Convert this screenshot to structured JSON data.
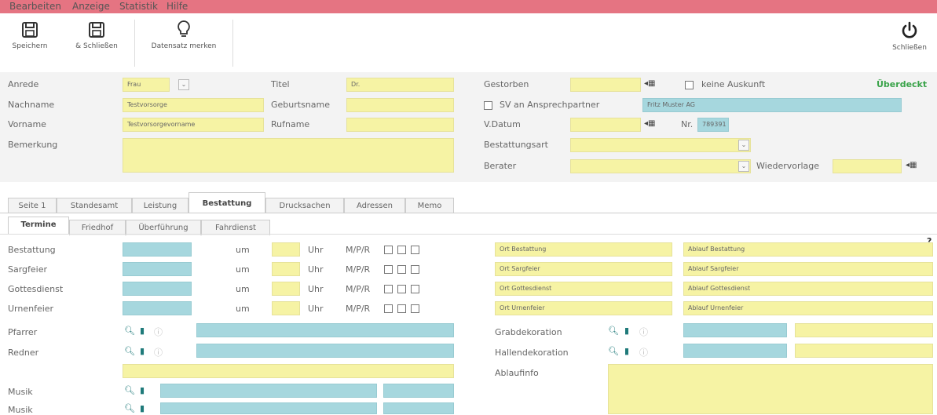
{
  "menu": [
    "Bearbeiten",
    "Anzeige",
    "Statistik",
    "Hilfe"
  ],
  "toolbar": {
    "save": "Speichern",
    "save_close": "& Schließen",
    "bookmark": "Datensatz merken",
    "close": "Schließen"
  },
  "person": {
    "anrede_label": "Anrede",
    "anrede_value": "Frau",
    "nachname_label": "Nachname",
    "nachname_value": "Testvorsorge",
    "vorname_label": "Vorname",
    "vorname_value": "Testvorsorgevorname",
    "bemerkung_label": "Bemerkung",
    "titel_label": "Titel",
    "titel_value": "Dr.",
    "geburtsname_label": "Geburtsname",
    "rufname_label": "Rufname"
  },
  "death": {
    "gestorben_label": "Gestorben",
    "keine_auskunft": "keine Auskunft",
    "sv_label": "SV an Ansprechpartner",
    "sv_value": "Fritz Muster AG",
    "vdatum_label": "V.Datum",
    "nr_label": "Nr.",
    "nr_value": "789391",
    "bestattungsart_label": "Bestattungsart",
    "berater_label": "Berater",
    "wiedervorlage_label": "Wiedervorlage",
    "status": "Überdeckt"
  },
  "tabs": [
    "Seite 1",
    "Standesamt",
    "Leistung",
    "Bestattung",
    "Drucksachen",
    "Adressen",
    "Memo"
  ],
  "subtabs": [
    "Termine",
    "Friedhof",
    "Überführung",
    "Fahrdienst"
  ],
  "termine": {
    "um": "um",
    "uhr": "Uhr",
    "mpr": "M/P/R",
    "rows": [
      {
        "label": "Bestattung",
        "ort": "Ort Bestattung",
        "ablauf": "Ablauf Bestattung"
      },
      {
        "label": "Sargfeier",
        "ort": "Ort Sargfeier",
        "ablauf": "Ablauf Sargfeier"
      },
      {
        "label": "Gottesdienst",
        "ort": "Ort Gottesdienst",
        "ablauf": "Ablauf Gottesdienst"
      },
      {
        "label": "Urnenfeier",
        "ort": "Ort Urnenfeier",
        "ablauf": "Ablauf Urnenfeier"
      }
    ],
    "help": "?"
  },
  "lower": {
    "pfarrer": "Pfarrer",
    "redner": "Redner",
    "musik1": "Musik",
    "musik2": "Musik",
    "grabdekoration": "Grabdekoration",
    "hallendekoration": "Hallendekoration",
    "ablaufinfo": "Ablaufinfo"
  },
  "icons": {
    "search": "magnifier-icon",
    "delete": "trash-icon",
    "info": "info-icon",
    "calendar": "calendar-icon"
  },
  "colors": {
    "menubar": "#e57482",
    "field_yellow": "#f6f3a4",
    "field_blue": "#a6d7de",
    "status_green": "#3aa34a"
  }
}
